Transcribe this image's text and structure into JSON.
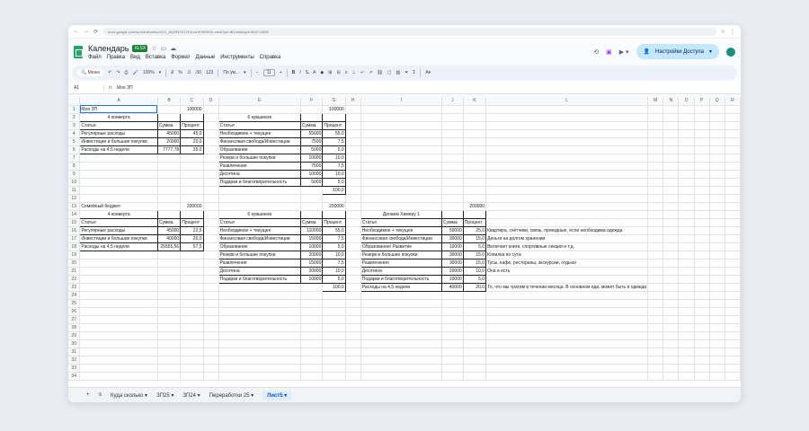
{
  "browser": {
    "url": "docs.google.com/spreadsheets/d/1O_Ab4R87KTcS1hcz9H3R9Gb-cdcbXpn-fB2/edit#gid=852711550"
  },
  "app": {
    "title": "Календарь",
    "badge": "XLSX",
    "menus": [
      "Файл",
      "Правка",
      "Вид",
      "Вставка",
      "Формат",
      "Данные",
      "Инструменты",
      "Справка"
    ],
    "share_label": "Настройки Доступа"
  },
  "toolbar": {
    "search": "Меню",
    "zoom": "100%",
    "format_123": "123",
    "font": "По ум...",
    "font_size": "11",
    "bold": "B",
    "italic": "I"
  },
  "formula_bar": {
    "cell_ref": "A1",
    "fx": "fx",
    "value": "Моя ЗП"
  },
  "columns": [
    "",
    "A",
    "B",
    "C",
    "D",
    "E",
    "F",
    "G",
    "H",
    "I",
    "J",
    "K",
    "L",
    "M",
    "N",
    "O",
    "P",
    "Q",
    "R"
  ],
  "rows": [
    [
      "Моя ЗП",
      "",
      "100000",
      "",
      "",
      "",
      "100000",
      "",
      "",
      "",
      "",
      "",
      "",
      "",
      "",
      "",
      "",
      ""
    ],
    [
      "4 конверта",
      "",
      "",
      "",
      "6 кувшинов",
      "",
      "",
      "",
      "",
      "",
      "",
      "",
      "",
      "",
      "",
      "",
      "",
      ""
    ],
    [
      "Статья",
      "Сумма",
      "Процент",
      "",
      "Статья",
      "Сумма",
      "Процент",
      "",
      "",
      "",
      "",
      "",
      "",
      "",
      "",
      "",
      "",
      ""
    ],
    [
      "Регулярные расходы",
      "45000",
      "45,0",
      "",
      "Необходимое + текущее",
      "55000",
      "55,0",
      "",
      "",
      "",
      "",
      "",
      "",
      "",
      "",
      "",
      "",
      ""
    ],
    [
      "Инвестиции и большие покупки",
      "20000",
      "20,0",
      "",
      "Финансовая свобода/Инвестиции",
      "7500",
      "7,5",
      "",
      "",
      "",
      "",
      "",
      "",
      "",
      "",
      "",
      "",
      ""
    ],
    [
      "Расходы на 4,5 недели",
      "7777,78",
      "35,0",
      "",
      "Образование",
      "5000",
      "5,0",
      "",
      "",
      "",
      "",
      "",
      "",
      "",
      "",
      "",
      "",
      ""
    ],
    [
      "",
      "",
      "",
      "",
      "Резерв и большие покупки",
      "10000",
      "10,0",
      "",
      "",
      "",
      "",
      "",
      "",
      "",
      "",
      "",
      "",
      ""
    ],
    [
      "",
      "",
      "",
      "",
      "Развлечения",
      "7500",
      "7,5",
      "",
      "",
      "",
      "",
      "",
      "",
      "",
      "",
      "",
      "",
      ""
    ],
    [
      "",
      "",
      "",
      "",
      "Десятина",
      "10000",
      "10,0",
      "",
      "",
      "",
      "",
      "",
      "",
      "",
      "",
      "",
      "",
      ""
    ],
    [
      "",
      "",
      "",
      "",
      "Подарки и благотворительность",
      "5000",
      "5,0",
      "",
      "",
      "",
      "",
      "",
      "",
      "",
      "",
      "",
      "",
      ""
    ],
    [
      "",
      "",
      "",
      "",
      "",
      "",
      "100,0",
      "",
      "",
      "",
      "",
      "",
      "",
      "",
      "",
      "",
      "",
      ""
    ],
    [
      "",
      "",
      "",
      "",
      "",
      "",
      "",
      "",
      "",
      "",
      "",
      "",
      "",
      "",
      "",
      "",
      "",
      ""
    ],
    [
      "Семейный бюджет",
      "",
      "200000",
      "",
      "",
      "",
      "200000",
      "",
      "",
      "",
      "200000",
      "",
      "",
      "",
      "",
      "",
      "",
      ""
    ],
    [
      "4 конверта",
      "",
      "",
      "",
      "6 кувшинов",
      "",
      "",
      "",
      "Делаем Химеру 1",
      "",
      "",
      "",
      "",
      "",
      "",
      "",
      "",
      ""
    ],
    [
      "Статья",
      "Сумма",
      "Процент",
      "",
      "Статья",
      "Сумма",
      "Процент",
      "",
      "Статья",
      "Сумма",
      "Процент",
      "",
      "",
      "",
      "",
      "",
      "",
      ""
    ],
    [
      "Регулярные расходы",
      "45000",
      "22,5",
      "",
      "Необходимое + текущее",
      "110000",
      "55,0",
      "",
      "Необходимое + текущее",
      "50000",
      "25,0",
      "Квартира, счётчики, связь, проездные, если необходима одежда",
      "",
      "",
      "",
      "",
      "",
      ""
    ],
    [
      "Инвестиции и большие покупки",
      "40000",
      "20,0",
      "",
      "Финансовая свобода/Инвестиции",
      "15000",
      "7,5",
      "",
      "Финансовая свобода/Инвестиции",
      "30000",
      "15,0",
      "Деньги на долгом хранении",
      "",
      "",
      "",
      "",
      "",
      ""
    ],
    [
      "Расходы на 4,5 недели",
      "25555,56",
      "57,5",
      "",
      "Образование",
      "10000",
      "5,0",
      "",
      "Образование/ Развитие",
      "10000",
      "5,0",
      "Включает книги, спортивные секции и т.д.",
      "",
      "",
      "",
      "",
      "",
      ""
    ],
    [
      "",
      "",
      "",
      "",
      "Резерв и большие покупки",
      "20000",
      "10,0",
      "",
      "Резерв и большие покупки",
      "30000",
      "15,0",
      "Копилка по сути",
      "",
      "",
      "",
      "",
      "",
      ""
    ],
    [
      "",
      "",
      "",
      "",
      "Развлечения",
      "15000",
      "7,5",
      "",
      "Развлечения",
      "30000",
      "15,0",
      "Тусы, кафе, рестораны, экскурсии, отдыхи",
      "",
      "",
      "",
      "",
      "",
      ""
    ],
    [
      "",
      "",
      "",
      "",
      "Десятина",
      "20000",
      "10,0",
      "",
      "Десятина",
      "20000",
      "10,0",
      "Она и есть",
      "",
      "",
      "",
      "",
      "",
      ""
    ],
    [
      "",
      "",
      "",
      "",
      "Подарки и благотворительность",
      "10000",
      "5,0",
      "",
      "Подарки и благотворительность",
      "10000",
      "5,0",
      "",
      "",
      "",
      "",
      "",
      "",
      ""
    ],
    [
      "",
      "",
      "",
      "",
      "",
      "",
      "100,0",
      "",
      "Расходы на 4,5 недели",
      "40000",
      "20,0",
      "То, что мы тратим в течении месяца. В основном еда, может быть и одежда",
      "",
      "",
      "",
      "",
      "",
      ""
    ]
  ],
  "empty_row_count": 11,
  "sheet_tabs": [
    "Куда сколько",
    "ЗП25",
    "ЗП24",
    "Переработки 25",
    "Лист5"
  ],
  "active_tab": "Лист5"
}
